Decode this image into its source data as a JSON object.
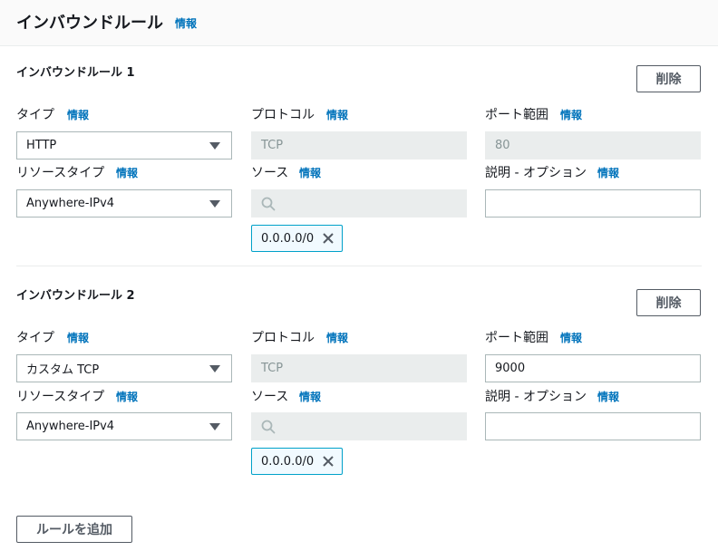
{
  "header": {
    "title": "インバウンドルール",
    "info": "情報"
  },
  "rules": [
    {
      "title": "インバウンドルール 1",
      "delete_label": "削除",
      "type_label": "タイプ",
      "type_info": "情報",
      "type_value": "HTTP",
      "protocol_label": "プロトコル",
      "protocol_info": "情報",
      "protocol_value": "TCP",
      "port_label": "ポート範囲",
      "port_info": "情報",
      "port_value": "80",
      "source_type_label": "リソースタイプ",
      "source_type_info": "情報",
      "source_type_value": "Anywhere-IPv4",
      "source_label": "ソース",
      "source_info": "情報",
      "source_search_value": "",
      "source_token": "0.0.0.0/0",
      "desc_label": "説明 - オプション",
      "desc_info": "情報",
      "desc_value": ""
    },
    {
      "title": "インバウンドルール 2",
      "delete_label": "削除",
      "type_label": "タイプ",
      "type_info": "情報",
      "type_value": "カスタム TCP",
      "protocol_label": "プロトコル",
      "protocol_info": "情報",
      "protocol_value": "TCP",
      "port_label": "ポート範囲",
      "port_info": "情報",
      "port_value": "9000",
      "source_type_label": "リソースタイプ",
      "source_type_info": "情報",
      "source_type_value": "Anywhere-IPv4",
      "source_label": "ソース",
      "source_info": "情報",
      "source_search_value": "",
      "source_token": "0.0.0.0/0",
      "desc_label": "説明 - オプション",
      "desc_info": "情報",
      "desc_value": ""
    }
  ],
  "add_rule_label": "ルールを追加",
  "icons": {
    "search": "search-icon",
    "remove": "close-icon",
    "dropdown": "caret-down-icon"
  },
  "colors": {
    "link": "#0073bb",
    "token_border": "#00a1c9",
    "token_bg": "#f1faff"
  }
}
